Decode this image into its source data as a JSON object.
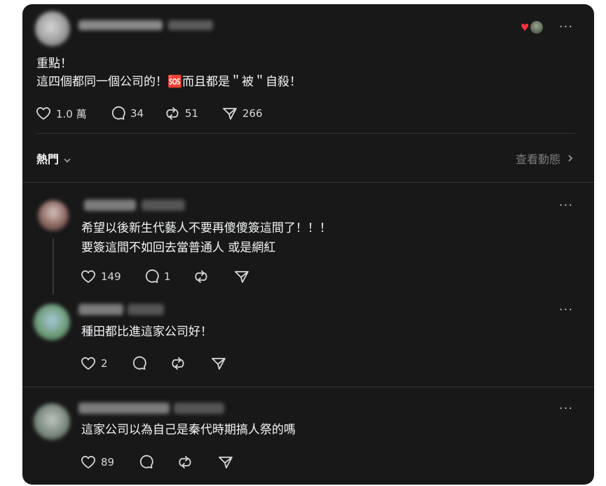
{
  "post": {
    "lines": [
      "重點！",
      "這四個都同一個公司的！🆘而且都是＂被＂自殺！"
    ],
    "like_count": "1.0 萬",
    "comment_count": "34",
    "repost_count": "51",
    "share_count": "266"
  },
  "sort": {
    "label": "熱門",
    "view_activity": "查看動態"
  },
  "comments": [
    {
      "lines": [
        "希望以後新生代藝人不要再傻傻簽這間了！！！",
        "要簽這間不如回去當普通人 或是網紅"
      ],
      "like_count": "149",
      "comment_count": "1"
    },
    {
      "lines": [
        "種田都比進這家公司好！"
      ],
      "like_count": "2"
    },
    {
      "lines": [
        "這家公司以為自己是秦代時期搞人祭的嗎"
      ],
      "like_count": "89"
    }
  ],
  "icons": {
    "like": "heart-outline-icon",
    "comment": "speech-bubble-icon",
    "repost": "repost-arrows-icon",
    "share": "paper-plane-icon",
    "more": "more-dots-icon"
  },
  "colors": {
    "background": "#181818",
    "text": "#f3f5f7",
    "muted": "#7d7d7d",
    "liked_heart": "#ff3040"
  }
}
